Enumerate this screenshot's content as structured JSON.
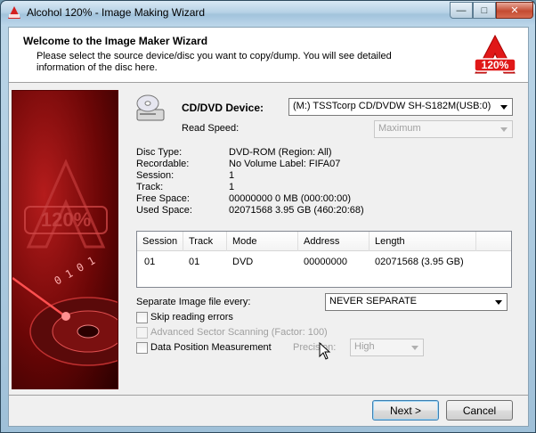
{
  "window": {
    "title": "Alcohol 120% - Image Making Wizard",
    "close_glyph": "✕",
    "min_glyph": "—",
    "max_glyph": "□"
  },
  "header": {
    "title": "Welcome to the Image Maker Wizard",
    "description": "Please select the source device/disc you want to copy/dump. You will see detailed information of the disc here.",
    "logo_text": "120%",
    "logo_letter": "A"
  },
  "device": {
    "label": "CD/DVD Device:",
    "selected": "(M:) TSSTcorp CD/DVDW SH-S182M(USB:0)",
    "read_speed_label": "Read Speed:",
    "read_speed_value": "Maximum"
  },
  "disc_info": [
    {
      "key": "Disc Type:",
      "value": "DVD-ROM  (Region: All)"
    },
    {
      "key": "Recordable:",
      "value": "No      Volume Label:  FIFA07"
    },
    {
      "key": "Session:",
      "value": "1"
    },
    {
      "key": "Track:",
      "value": "1"
    },
    {
      "key": "Free Space:",
      "value": "00000000    0 MB    (000:00:00)"
    },
    {
      "key": "Used Space:",
      "value": "02071568    3.95 GB    (460:20:68)"
    }
  ],
  "table": {
    "headers": [
      "Session",
      "Track",
      "Mode",
      "Address",
      "Length"
    ],
    "rows": [
      [
        "01",
        "01",
        "DVD",
        "00000000",
        "02071568 (3.95 GB)"
      ]
    ]
  },
  "options": {
    "separate_label": "Separate Image file every:",
    "separate_value": "NEVER SEPARATE",
    "skip_errors": "Skip reading errors",
    "advanced_scanning": "Advanced Sector Scanning  (Factor: 100)",
    "data_position": "Data Position Measurement",
    "precision_label": "Precision:",
    "precision_value": "High"
  },
  "banner": {
    "text": "120%",
    "letter": "A",
    "bits": "0 1 0 1"
  },
  "buttons": {
    "next": "Next >",
    "cancel": "Cancel"
  }
}
